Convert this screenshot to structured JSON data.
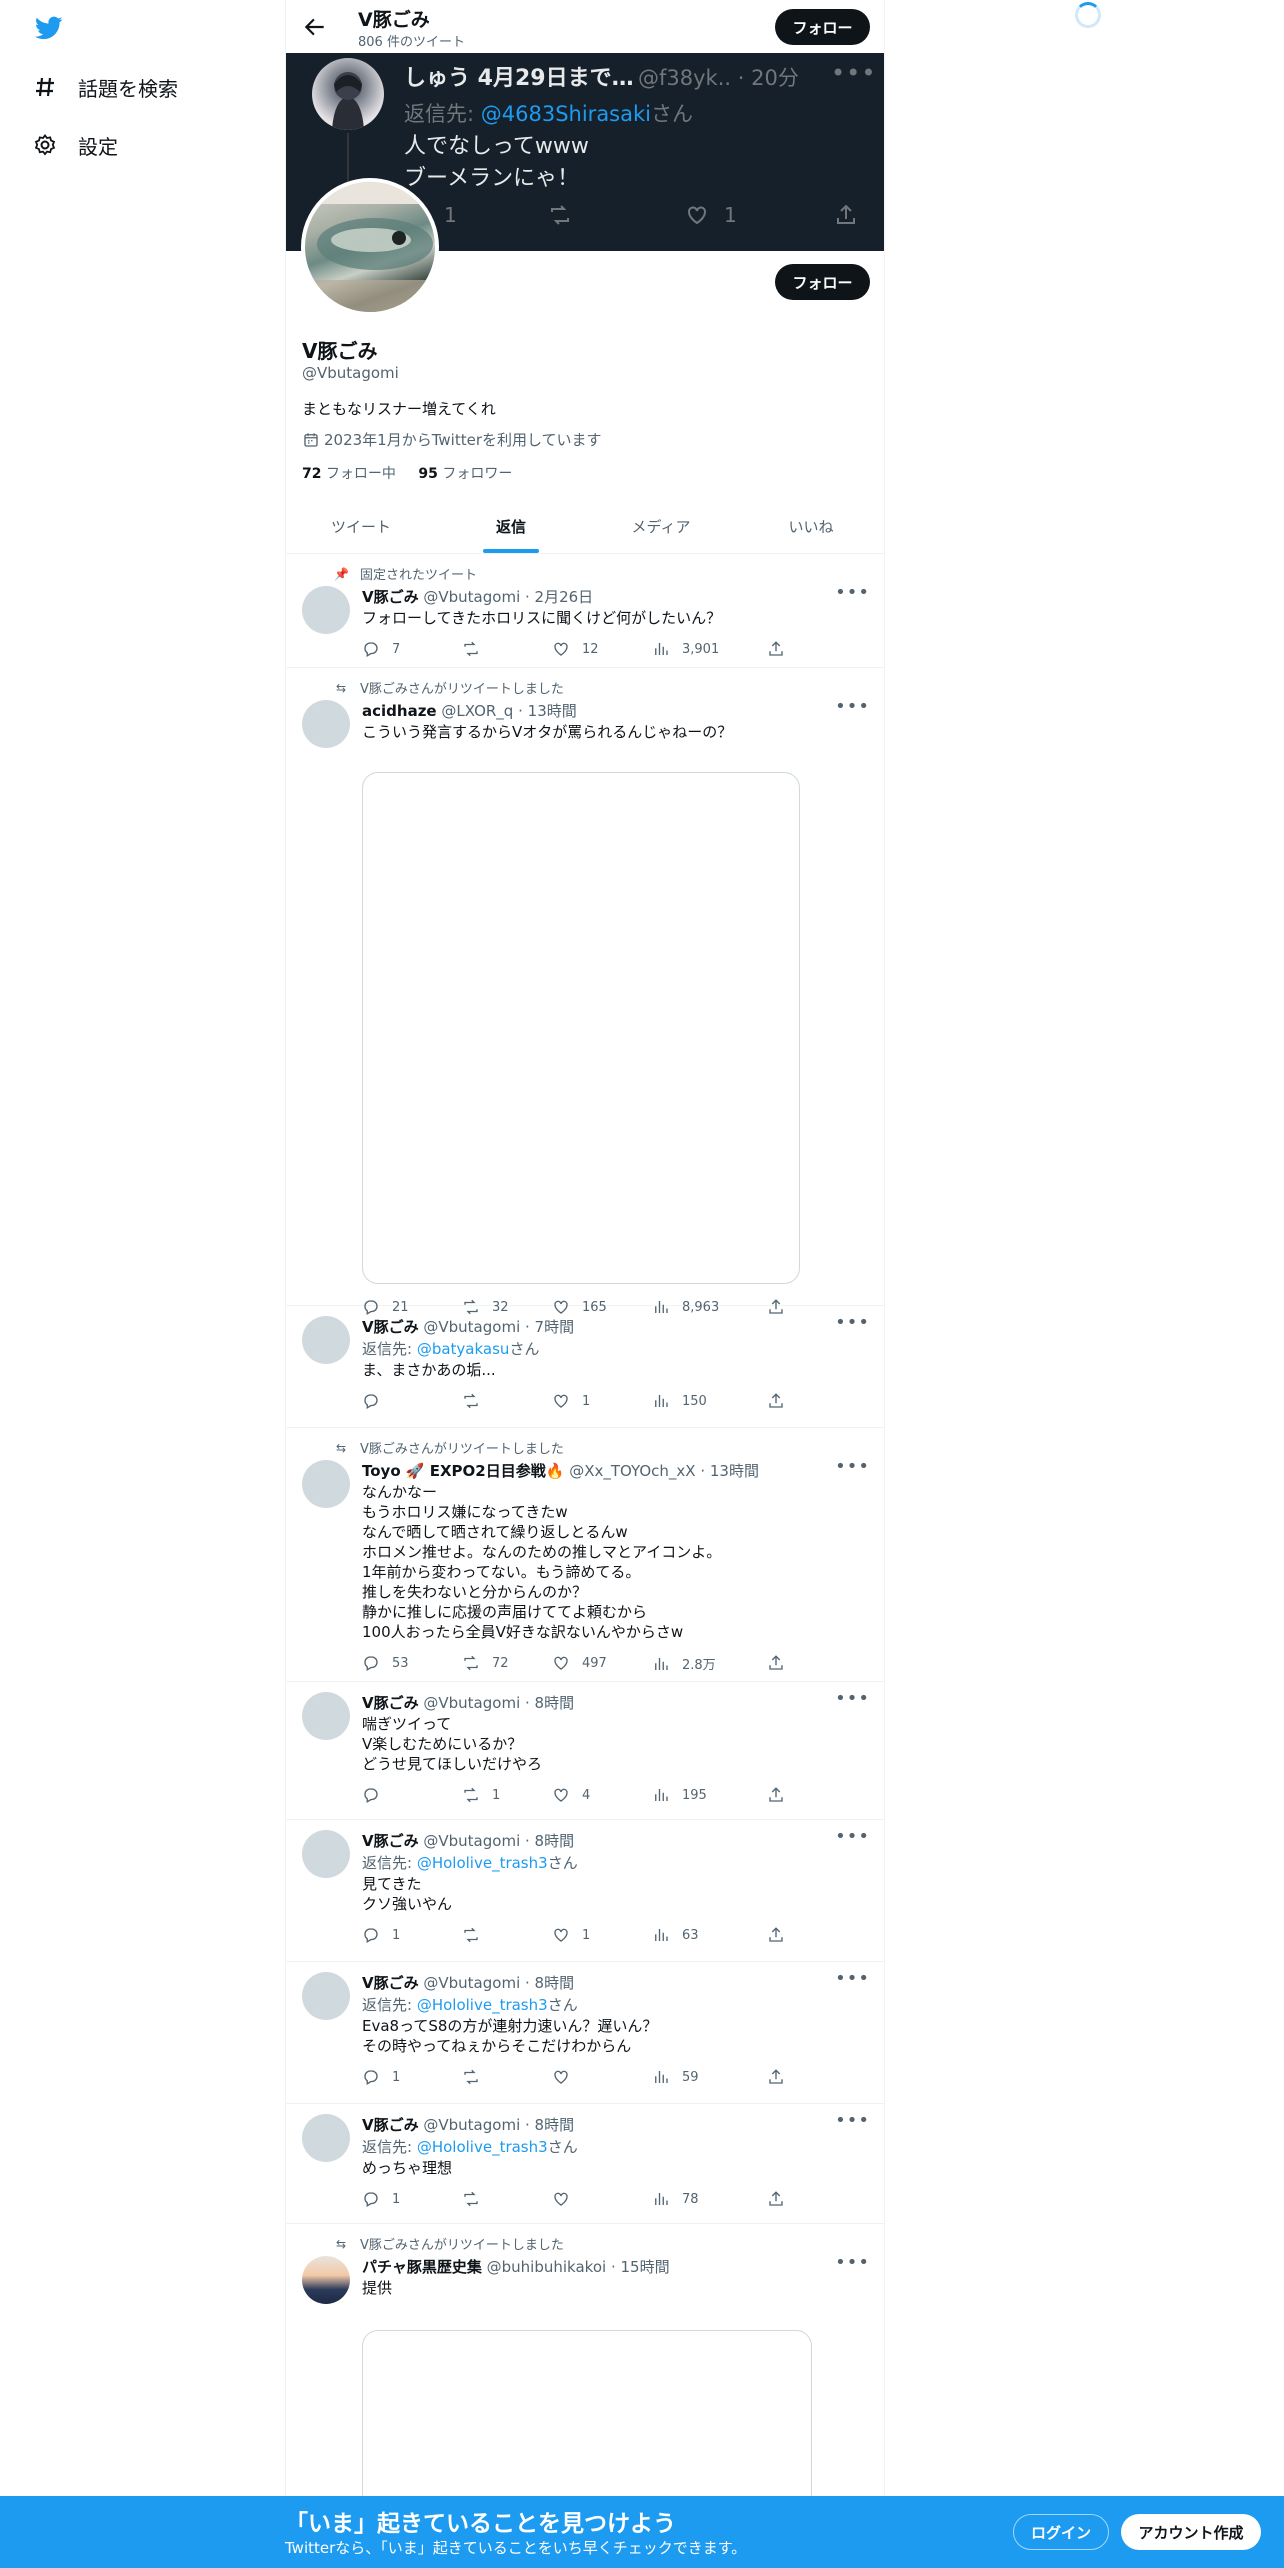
{
  "nav": {
    "explore": "話題を検索",
    "settings": "設定"
  },
  "header": {
    "name": "V豚ごみ",
    "tweet_count": "806 件のツイート",
    "follow": "フォロー"
  },
  "banner_tweet": {
    "name": "しゅう 4月29日まで…",
    "handle": "@f38yk..",
    "time": "· 20分",
    "reply_prefix": "返信先: ",
    "reply_mention": "@4683Shirasaki",
    "reply_suffix": "さん",
    "text": "人でなしってwww\nブーメランにゃ！",
    "reply_count": "1",
    "like_count": "1"
  },
  "profile": {
    "name": "V豚ごみ",
    "handle": "@Vbutagomi",
    "bio": "まともなリスナー増えてくれ",
    "joined": "2023年1月からTwitterを利用しています",
    "following_count": "72",
    "following_label": "フォロー中",
    "followers_count": "95",
    "followers_label": "フォロワー",
    "follow": "フォロー"
  },
  "tabs": [
    "ツイート",
    "返信",
    "メディア",
    "いいね"
  ],
  "tweets": [
    {
      "context": "固定されたツイート",
      "name": "V豚ごみ",
      "handle": "@Vbutagomi",
      "time": "· 2月26日",
      "text": "フォローしてきたホロリスに聞くけど何がしたいん？",
      "replies": "7",
      "retweets": "",
      "likes": "12",
      "views": "3,901"
    },
    {
      "context": "V豚ごみさんがリツイートしました",
      "name": "acidhaze",
      "handle": "@LXOR_q",
      "time": "· 13時間",
      "text": "こういう発言するからVオタが罵られるんじゃねーの？",
      "replies": "21",
      "retweets": "32",
      "likes": "165",
      "views": "8,963"
    },
    {
      "name": "V豚ごみ",
      "handle": "@Vbutagomi",
      "time": "· 7時間",
      "reply_prefix": "返信先: ",
      "reply_mention": "@batyakasu",
      "reply_suffix": "さん",
      "text": "ま、まさかあの垢...",
      "replies": "",
      "retweets": "",
      "likes": "1",
      "views": "150"
    },
    {
      "context": "V豚ごみさんがリツイートしました",
      "name": "Toyo 🚀 EXPO2日目参戦🔥",
      "handle": "@Xx_TOYOch_xX",
      "time": "· 13時間",
      "text": "なんかなー\nもうホロリス嫌になってきたw\nなんで晒して晒されて繰り返しとるんw\nホロメン推せよ。なんのための推しマとアイコンよ。\n1年前から変わってない。もう諦めてる。\n推しを失わないと分からんのか？\n静かに推しに応援の声届けててよ頼むから\n100人おったら全員V好きな訳ないんやからさw",
      "replies": "53",
      "retweets": "72",
      "likes": "497",
      "views": "2.8万"
    },
    {
      "name": "V豚ごみ",
      "handle": "@Vbutagomi",
      "time": "· 8時間",
      "text": "喘ぎツイって\nV楽しむためにいるか？\nどうせ見てほしいだけやろ",
      "replies": "",
      "retweets": "1",
      "likes": "4",
      "views": "195"
    },
    {
      "name": "V豚ごみ",
      "handle": "@Vbutagomi",
      "time": "· 8時間",
      "reply_prefix": "返信先: ",
      "reply_mention": "@Hololive_trash3",
      "reply_suffix": "さん",
      "text": "見てきた\nクソ強いやん",
      "replies": "1",
      "retweets": "",
      "likes": "1",
      "views": "63"
    },
    {
      "name": "V豚ごみ",
      "handle": "@Vbutagomi",
      "time": "· 8時間",
      "reply_prefix": "返信先: ",
      "reply_mention": "@Hololive_trash3",
      "reply_suffix": "さん",
      "text": "Eva8ってS8の方が連射力速いん？遅いん？\nその時やってねぇからそこだけわからん",
      "replies": "1",
      "retweets": "",
      "likes": "",
      "views": "59"
    },
    {
      "name": "V豚ごみ",
      "handle": "@Vbutagomi",
      "time": "· 8時間",
      "reply_prefix": "返信先: ",
      "reply_mention": "@Hololive_trash3",
      "reply_suffix": "さん",
      "text": "めっちゃ理想",
      "replies": "1",
      "retweets": "",
      "likes": "",
      "views": "78"
    },
    {
      "context": "V豚ごみさんがリツイートしました",
      "name": "パチャ豚黒歴史集",
      "handle": "@buhibuhikakoi",
      "time": "· 15時間",
      "text": "提供"
    }
  ],
  "bottom_banner": {
    "title": "「いま」起きていることを見つけよう",
    "subtitle": "Twitterなら、「いま」起きていることをいち早くチェックできます。",
    "login": "ログイン",
    "signup": "アカウント作成"
  },
  "colors": {
    "accent": "#1d9bf0",
    "dark": "#0f1419",
    "banner_bg": "#15202b"
  }
}
